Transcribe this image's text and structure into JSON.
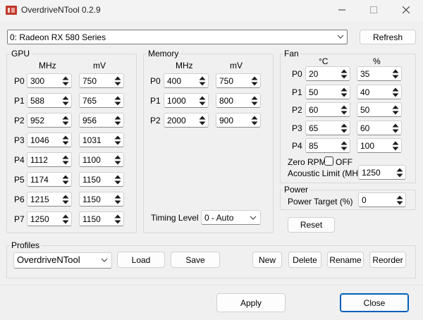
{
  "window": {
    "title": "OverdriveNTool 0.2.9"
  },
  "colors": {
    "accent": "#005fb8",
    "icon_red": "#c0392b"
  },
  "device": {
    "selected": "0: Radeon RX 580 Series",
    "refresh_label": "Refresh"
  },
  "gpu": {
    "title": "GPU",
    "col_mhz": "MHz",
    "col_mv": "mV",
    "states": [
      {
        "label": "P0",
        "mhz": "300",
        "mv": "750"
      },
      {
        "label": "P1",
        "mhz": "588",
        "mv": "765"
      },
      {
        "label": "P2",
        "mhz": "952",
        "mv": "956"
      },
      {
        "label": "P3",
        "mhz": "1046",
        "mv": "1031"
      },
      {
        "label": "P4",
        "mhz": "1112",
        "mv": "1100"
      },
      {
        "label": "P5",
        "mhz": "1174",
        "mv": "1150"
      },
      {
        "label": "P6",
        "mhz": "1215",
        "mv": "1150"
      },
      {
        "label": "P7",
        "mhz": "1250",
        "mv": "1150"
      }
    ]
  },
  "memory": {
    "title": "Memory",
    "col_mhz": "MHz",
    "col_mv": "mV",
    "states": [
      {
        "label": "P0",
        "mhz": "400",
        "mv": "750"
      },
      {
        "label": "P1",
        "mhz": "1000",
        "mv": "800"
      },
      {
        "label": "P2",
        "mhz": "2000",
        "mv": "900"
      }
    ],
    "timing_label": "Timing Level",
    "timing_value": "0 - Auto"
  },
  "fan": {
    "title": "Fan",
    "col_c": "°C",
    "col_pct": "%",
    "points": [
      {
        "label": "P0",
        "temp": "20",
        "pct": "35"
      },
      {
        "label": "P1",
        "temp": "50",
        "pct": "40"
      },
      {
        "label": "P2",
        "temp": "60",
        "pct": "50"
      },
      {
        "label": "P3",
        "temp": "65",
        "pct": "60"
      },
      {
        "label": "P4",
        "temp": "85",
        "pct": "100"
      }
    ],
    "zero_rpm_label": "Zero RPM",
    "zero_rpm_state": "OFF",
    "acoustic_label": "Acoustic Limit (MHz)",
    "acoustic_value": "1250"
  },
  "power": {
    "title": "Power",
    "target_label": "Power Target (%)",
    "target_value": "0"
  },
  "reset_label": "Reset",
  "profiles": {
    "title": "Profiles",
    "selected": "OverdriveNTool",
    "load": "Load",
    "save": "Save",
    "new": "New",
    "delete": "Delete",
    "rename": "Rename",
    "reorder": "Reorder"
  },
  "footer": {
    "apply": "Apply",
    "close": "Close"
  }
}
